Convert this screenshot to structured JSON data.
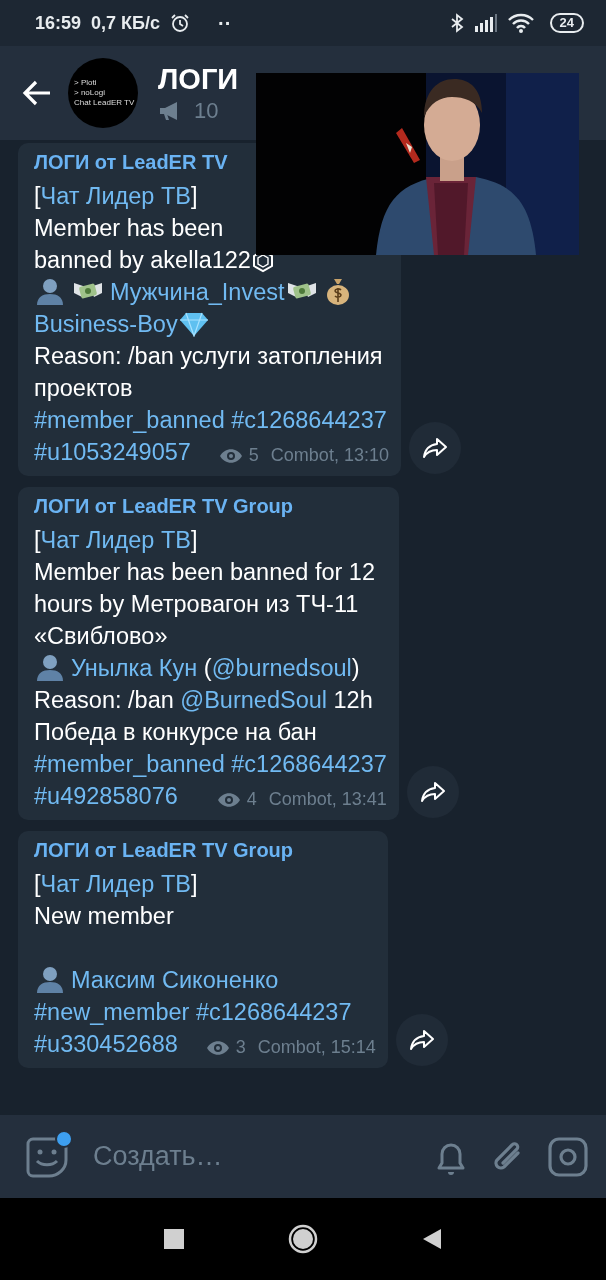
{
  "status_bar": {
    "time": "16:59",
    "speed": "0,7 КБ/с",
    "dots": "··",
    "battery": "24"
  },
  "header": {
    "avatar_lines": [
      "> Ploti",
      "> noLogi",
      "Chat LeadER TV"
    ],
    "title": "ЛОГИ",
    "subscribers": "10"
  },
  "messages": [
    {
      "sender": "ЛОГИ от LeadER TV",
      "lines": [
        [
          {
            "kind": "text",
            "text": "["
          },
          {
            "kind": "link",
            "text": "Чат Лидер ТВ"
          },
          {
            "kind": "text",
            "text": "]"
          }
        ],
        [
          {
            "kind": "text",
            "text": "Member has been"
          }
        ],
        [
          {
            "kind": "text",
            "text": "banned by akella122"
          },
          {
            "kind": "hex"
          }
        ],
        [
          {
            "kind": "user"
          },
          {
            "kind": "cash"
          },
          {
            "kind": "link",
            "text": "Мужчина_Invest"
          },
          {
            "kind": "cash"
          },
          {
            "kind": "bag"
          }
        ],
        [
          {
            "kind": "link",
            "text": "Business-Boy"
          },
          {
            "kind": "gem"
          }
        ],
        [
          {
            "kind": "text",
            "text": "Reason: /ban услуги затопления"
          }
        ],
        [
          {
            "kind": "text",
            "text": "проектов"
          }
        ],
        [
          {
            "kind": "link",
            "text": "#member_banned #c1268644237"
          }
        ],
        [
          {
            "kind": "link",
            "text": "#u1053249057"
          }
        ]
      ],
      "views": "5",
      "signature": "Combot, 13:10"
    },
    {
      "sender": "ЛОГИ от LeadER TV Group",
      "lines": [
        [
          {
            "kind": "text",
            "text": "["
          },
          {
            "kind": "link",
            "text": "Чат Лидер ТВ"
          },
          {
            "kind": "text",
            "text": "]"
          }
        ],
        [
          {
            "kind": "text",
            "text": "Member has been banned for 12"
          }
        ],
        [
          {
            "kind": "text",
            "text": "hours by Метровагон из ТЧ-11"
          }
        ],
        [
          {
            "kind": "text",
            "text": "«Свиблово»"
          }
        ],
        [
          {
            "kind": "user"
          },
          {
            "kind": "link",
            "text": "Унылка Кун"
          },
          {
            "kind": "text",
            "text": " ("
          },
          {
            "kind": "link",
            "text": "@burnedsoul"
          },
          {
            "kind": "text",
            "text": ")"
          }
        ],
        [
          {
            "kind": "text",
            "text": "Reason: /ban "
          },
          {
            "kind": "link",
            "text": "@BurnedSoul"
          },
          {
            "kind": "text",
            "text": " 12h"
          }
        ],
        [
          {
            "kind": "text",
            "text": "Победа в конкурсе на бан"
          }
        ],
        [
          {
            "kind": "link",
            "text": "#member_banned #c1268644237"
          }
        ],
        [
          {
            "kind": "link",
            "text": "#u492858076"
          }
        ]
      ],
      "views": "4",
      "signature": "Combot, 13:41"
    },
    {
      "sender": "ЛОГИ от LeadER TV Group",
      "lines": [
        [
          {
            "kind": "text",
            "text": "["
          },
          {
            "kind": "link",
            "text": "Чат Лидер ТВ"
          },
          {
            "kind": "text",
            "text": "]"
          }
        ],
        [
          {
            "kind": "text",
            "text": "New member"
          }
        ],
        [
          {
            "kind": "blank"
          }
        ],
        [
          {
            "kind": "user"
          },
          {
            "kind": "link",
            "text": "Максим Сиконенко"
          }
        ],
        [
          {
            "kind": "link",
            "text": "#new_member #c1268644237"
          }
        ],
        [
          {
            "kind": "link",
            "text": "#u330452688"
          }
        ]
      ],
      "views": "3",
      "signature": "Combot, 15:14"
    }
  ],
  "composer": {
    "placeholder": "Создать…",
    "sticker_badge": true
  }
}
